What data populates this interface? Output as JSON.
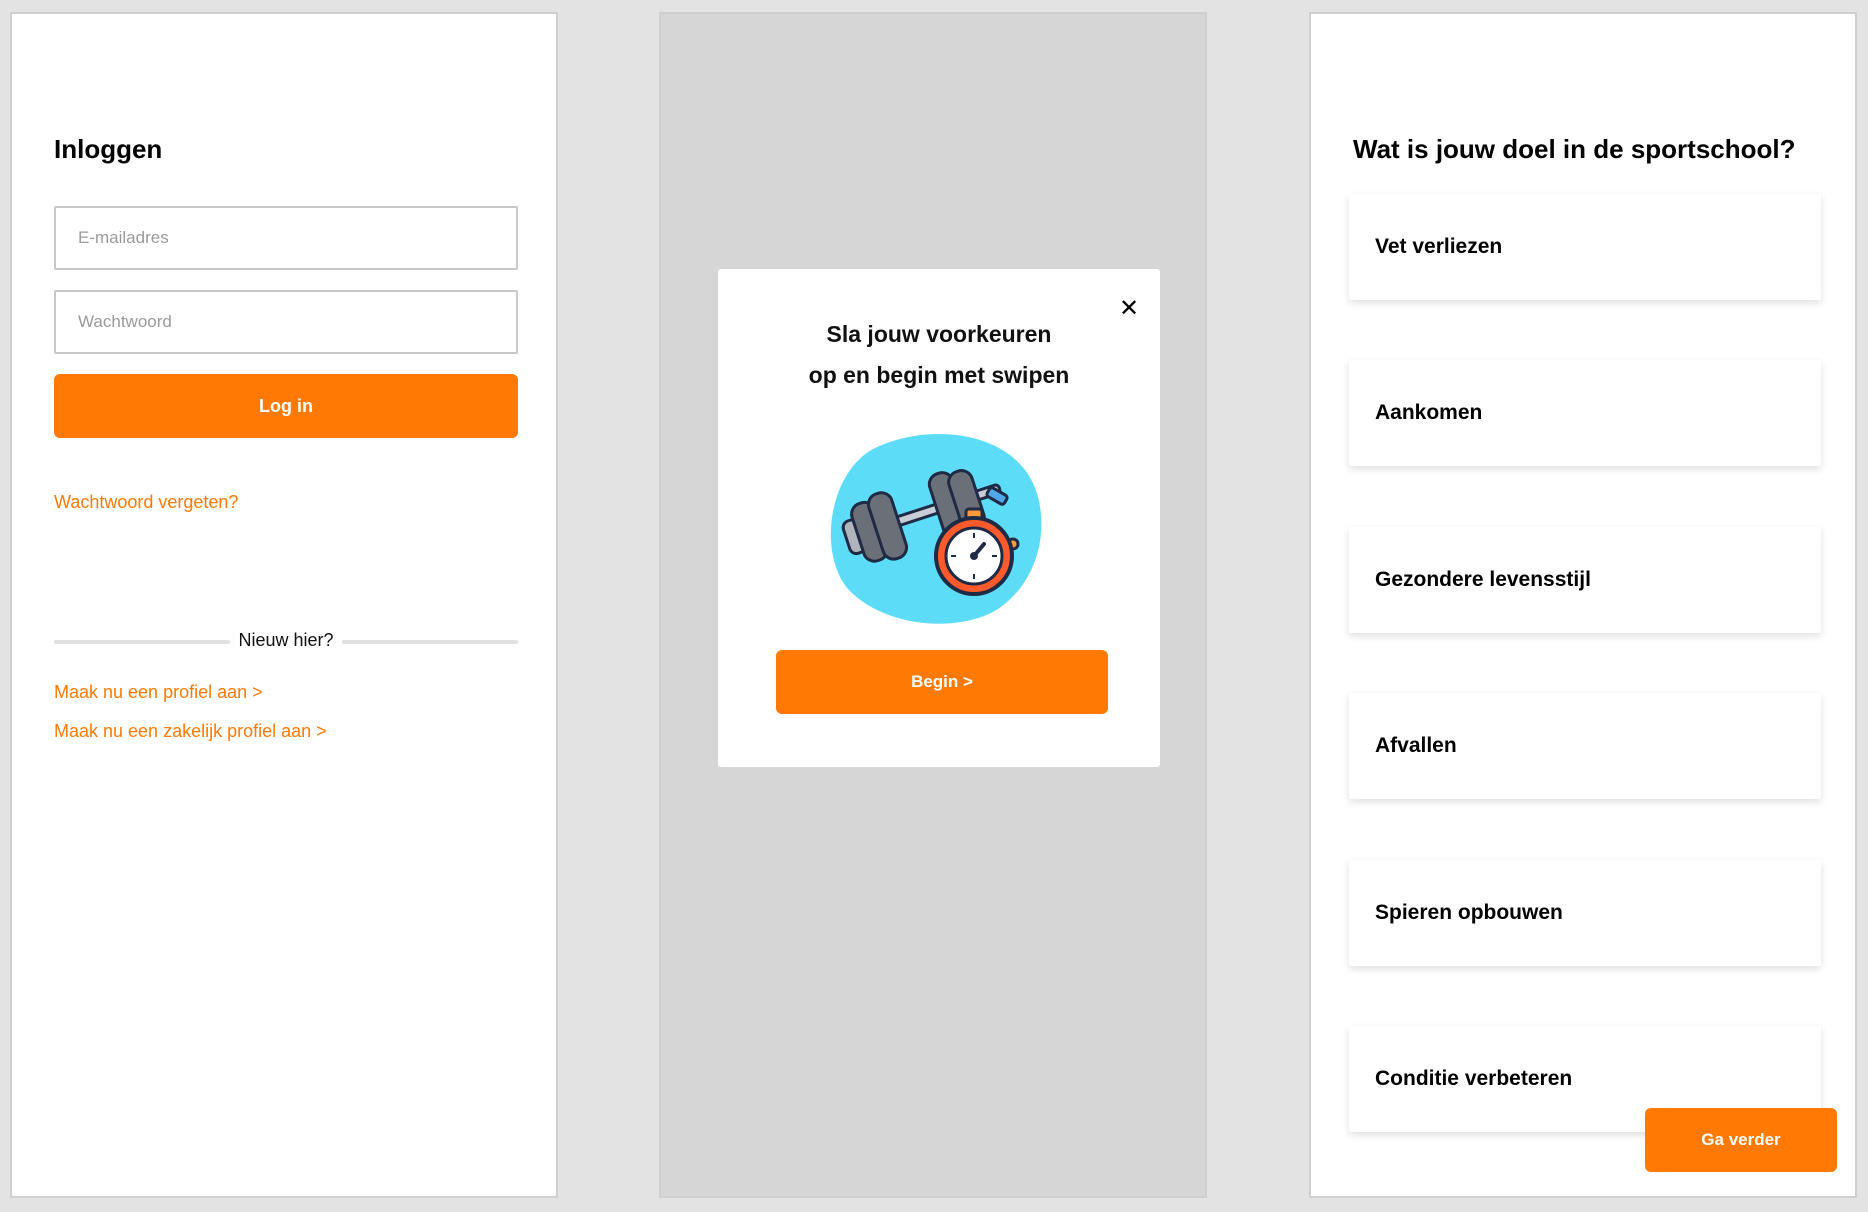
{
  "login": {
    "title": "Inloggen",
    "email_placeholder": "E-mailadres",
    "password_placeholder": "Wachtwoord",
    "login_button": "Log in",
    "forgot_password": "Wachtwoord vergeten?",
    "new_here": "Nieuw hier?",
    "signup_link": "Maak nu een profiel aan >",
    "business_signup_link": "Maak nu een zakelijk profiel aan >"
  },
  "modal": {
    "title_line1": "Sla jouw voorkeuren",
    "title_line2": "op en begin met swipen",
    "close_icon": "close-icon",
    "illustration": "dumbbell-stopwatch-illustration",
    "begin_button": "Begin >"
  },
  "goals": {
    "title": "Wat is jouw doel in de sportschool?",
    "options": [
      "Vet verliezen",
      "Aankomen",
      "Gezondere levensstijl",
      "Afvallen",
      "Spieren opbouwen",
      "Conditie verbeteren"
    ],
    "continue_button": "Ga verder"
  },
  "colors": {
    "accent": "#ff7a05",
    "overlay": "#d6d6d6",
    "illustration_blob": "#5ddcf7"
  }
}
